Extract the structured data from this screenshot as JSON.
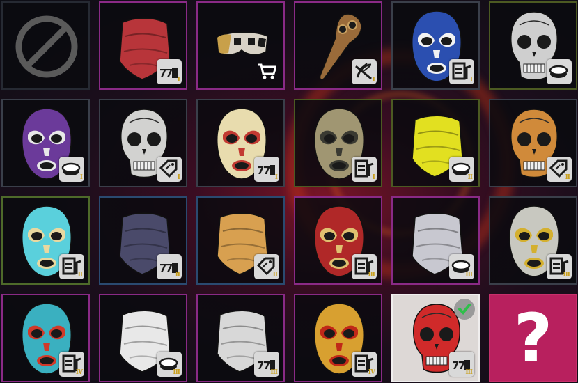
{
  "grid": {
    "items": [
      {
        "kind": "none",
        "border": "b-dark",
        "icon": "no-mask-icon"
      },
      {
        "kind": "bandana",
        "color": "#b8353a",
        "pattern": "paisley",
        "border": "b-purple",
        "badge": "slot-icon",
        "tier": "I"
      },
      {
        "kind": "eyemask",
        "color": "#d8d2c6",
        "pattern": "checker",
        "border": "b-purple",
        "badge": "cart-icon",
        "tier": ""
      },
      {
        "kind": "plague",
        "color": "#9a6b3a",
        "border": "b-purple",
        "badge": "boost-icon",
        "tier": "I"
      },
      {
        "kind": "lucha",
        "color": "#2b4fb0",
        "accent": "#f2f2f2",
        "border": "b-grey",
        "badge": "atm-icon",
        "tier": "I"
      },
      {
        "kind": "skull",
        "color": "#cfcfcf",
        "border": "b-olive",
        "badge": "coin-icon",
        "tier": ""
      },
      {
        "kind": "lucha",
        "color": "#6b3a9a",
        "accent": "#e8e8e8",
        "border": "b-grey",
        "badge": "coin-icon",
        "tier": "I"
      },
      {
        "kind": "skull",
        "color": "#d2d2d0",
        "border": "b-grey",
        "badge": "tag-icon",
        "tier": "I"
      },
      {
        "kind": "lucha",
        "color": "#e8dcae",
        "accent": "#c23a32",
        "border": "b-grey",
        "badge": "slot-icon",
        "tier": "I"
      },
      {
        "kind": "lucha",
        "color": "#a09672",
        "accent": "#3a3a32",
        "border": "b-olive",
        "badge": "atm-icon",
        "tier": "I"
      },
      {
        "kind": "bandana",
        "color": "#e2e020",
        "pattern": "plain",
        "border": "b-olive",
        "badge": "coin-icon",
        "tier": "II"
      },
      {
        "kind": "skull",
        "color": "#d08a3a",
        "border": "b-grey",
        "badge": "tag-icon",
        "tier": "II"
      },
      {
        "kind": "lucha",
        "color": "#5ad0dc",
        "accent": "#e8d8a0",
        "border": "b-green",
        "badge": "atm-icon",
        "tier": "II"
      },
      {
        "kind": "bandana",
        "color": "#4a4a6a",
        "pattern": "flame",
        "border": "b-blue",
        "badge": "slot-icon",
        "tier": "II"
      },
      {
        "kind": "bandana",
        "color": "#d8a050",
        "pattern": "lips",
        "border": "b-blue",
        "badge": "tag-icon",
        "tier": "II"
      },
      {
        "kind": "lucha",
        "color": "#b02828",
        "accent": "#e0c070",
        "border": "b-purple",
        "badge": "atm-icon",
        "tier": "III"
      },
      {
        "kind": "bandana",
        "color": "#c8c8d0",
        "pattern": "teeth",
        "border": "b-purple",
        "badge": "coin-icon",
        "tier": "III"
      },
      {
        "kind": "lucha",
        "color": "#c8c8c0",
        "accent": "#d4b030",
        "border": "b-grey",
        "badge": "atm-icon",
        "tier": "III"
      },
      {
        "kind": "lucha",
        "color": "#3ab0c0",
        "accent": "#d03a2a",
        "border": "b-purple",
        "badge": "atm-icon",
        "tier": "IV"
      },
      {
        "kind": "bandana",
        "color": "#e8e8e8",
        "pattern": "sugar",
        "border": "b-purple",
        "badge": "coin-icon",
        "tier": "III"
      },
      {
        "kind": "bandana",
        "color": "#d8d8d8",
        "pattern": "skeleton",
        "border": "b-purple",
        "badge": "slot-icon",
        "tier": "III"
      },
      {
        "kind": "lucha",
        "color": "#d8a030",
        "accent": "#c02818",
        "border": "b-purple",
        "badge": "atm-icon",
        "tier": "IV"
      },
      {
        "kind": "skull",
        "color": "#d02a2a",
        "border": "selected",
        "badge": "slot-icon",
        "tier": "III",
        "selected": true
      },
      {
        "kind": "mystery",
        "label": "?",
        "border": "mystery"
      }
    ]
  }
}
